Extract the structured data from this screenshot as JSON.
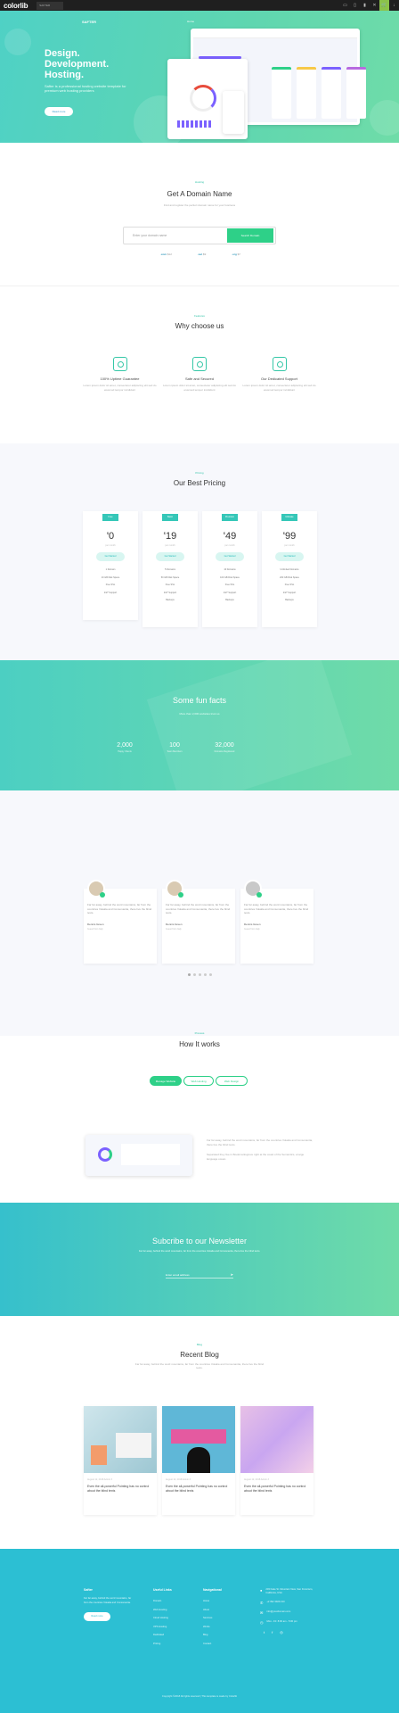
{
  "topbar": {
    "logo": "colorlib",
    "tab": "SAFTER",
    "icons": [
      "desktop-icon",
      "tablet-icon",
      "mobile-icon",
      "close-icon",
      "cart-icon",
      "download-icon"
    ]
  },
  "hero": {
    "brand": "SAFTER",
    "nav": "Home",
    "title": "Design. Development. Hosting.",
    "subtitle": "Safter is a professional hosting website template for premium web hosting providers",
    "button": "Read more",
    "mock": {
      "plan_names": [
        "Starter",
        "Business",
        "Premium",
        "Ultimate"
      ]
    }
  },
  "domain": {
    "label": "Hosting",
    "title": "Get A Domain Name",
    "subtitle": "Find and register the perfect domain name for your business",
    "placeholder": "Enter your domain name",
    "button": "Search Domain",
    "tlds": [
      {
        "ext": ".com",
        "price": "$12"
      },
      {
        "ext": ".net",
        "price": "$9"
      },
      {
        "ext": ".org",
        "price": "$7"
      }
    ]
  },
  "why": {
    "label": "Features",
    "title": "Why choose us",
    "features": [
      {
        "icon": "uptime-icon",
        "title": "100% Uptime Guarantee",
        "text": "Lorem ipsum dolor sit amet, consectetur adipiscing elit sed do eiusmod tempor incididunt"
      },
      {
        "icon": "shield-icon",
        "title": "Safe and Secured",
        "text": "Lorem ipsum dolor sit amet, consectetur adipiscing elit sed do eiusmod tempor incididunt"
      },
      {
        "icon": "support-icon",
        "title": "Our Dedicated Support",
        "text": "Lorem ipsum dolor sit amet, consectetur adipiscing elit sed do eiusmod tempor incididunt"
      }
    ]
  },
  "pricing": {
    "label": "Pricing",
    "title": "Our Best Pricing",
    "plans": [
      {
        "label": "Free",
        "price": "0",
        "per": "per month",
        "cta": "Get Started",
        "features": [
          "1 Domain",
          "10 GB Disk Space",
          "Free SSL",
          "24/7 Support"
        ]
      },
      {
        "label": "Basic",
        "price": "19",
        "per": "per month",
        "cta": "Get Started",
        "features": [
          "5 Domains",
          "50 GB Disk Space",
          "Free SSL",
          "24/7 Support",
          "Backups"
        ]
      },
      {
        "label": "Premium",
        "price": "49",
        "per": "per month",
        "cta": "Get Started",
        "features": [
          "10 Domains",
          "100 GB Disk Space",
          "Free SSL",
          "24/7 Support",
          "Backups"
        ]
      },
      {
        "label": "Ultimate",
        "price": "99",
        "per": "per month",
        "cta": "Get Started",
        "features": [
          "Unlimited Domains",
          "200 GB Disk Space",
          "Free SSL",
          "24/7 Support",
          "Backups"
        ]
      }
    ]
  },
  "facts": {
    "title": "Some fun facts",
    "subtitle": "More than 2,000 websites trust us",
    "items": [
      {
        "n": "2,000",
        "t": "Happy Clients"
      },
      {
        "n": "100",
        "t": "Team Members"
      },
      {
        "n": "32,000",
        "t": "Domains Registered"
      }
    ]
  },
  "testimonials": {
    "items": [
      {
        "quote": "Far far away, behind the word mountains, far from the countries Vokalia and Consonantia, there live the blind texts.",
        "name": "Dennis Green",
        "role": "Guest from Italy"
      },
      {
        "quote": "Far far away, behind the word mountains, far from the countries Vokalia and Consonantia, there live the blind texts.",
        "name": "Dennis Green",
        "role": "Guest from Italy"
      },
      {
        "quote": "Far far away, behind the word mountains, far from the countries Vokalia and Consonantia, there live the blind texts.",
        "name": "Dennis Green",
        "role": "Guest from Italy"
      }
    ]
  },
  "how": {
    "label": "Process",
    "title": "How It works",
    "tabs": [
      "Manage Website",
      "Web Hosting",
      "Web Design"
    ],
    "text1": "Far far away, behind the word mountains, far from the countries Vokalia and Consonantia, there live the blind texts.",
    "text2": "Separated they live in Bookmarksgrove right at the coast of the Semantics, a large language ocean."
  },
  "newsletter": {
    "title": "Subcribe to our Newsletter",
    "subtitle": "Far far away, behind the word mountains, far from the countries Vokalia and Consonantia, there live the blind texts.",
    "placeholder": "Enter email address"
  },
  "blog": {
    "label": "Blog",
    "title": "Recent Blog",
    "subtitle": "Far far away, behind the word mountains, far from the countries Vokalia and Consonantia, there live the blind texts.",
    "posts": [
      {
        "meta": "August 12, 2018  Admin  3",
        "title": "Even the all-powerful Pointing has no control about the blind texts"
      },
      {
        "meta": "August 12, 2018  Admin  3",
        "title": "Even the all-powerful Pointing has no control about the blind texts"
      },
      {
        "meta": "August 12, 2018  Admin  3",
        "title": "Even the all-powerful Pointing has no control about the blind texts"
      }
    ]
  },
  "footer": {
    "about": {
      "title": "Safter",
      "text": "Far far away, behind the word mountains, far from the countries Vokalia and Consonantia.",
      "button": "Read more"
    },
    "cols": [
      {
        "title": "Useful Links",
        "links": [
          "Domain",
          "Web Hosting",
          "Cloud Hosting",
          "VPS Hosting",
          "Dedicated",
          "Pricing"
        ]
      },
      {
        "title": "Navigational",
        "links": [
          "Home",
          "About",
          "Services",
          "Works",
          "Blog",
          "Contact"
        ]
      }
    ],
    "contact": [
      "203 Fake St. Mountain View, San Francisco, California, USA",
      "+2 392 3929 210",
      "info@yourdomain.com",
      "Mon - Fri: 8:00 am - 5:00 pm"
    ],
    "copyright": "Copyright ©2018 All rights reserved | This template is made by Colorlib"
  }
}
